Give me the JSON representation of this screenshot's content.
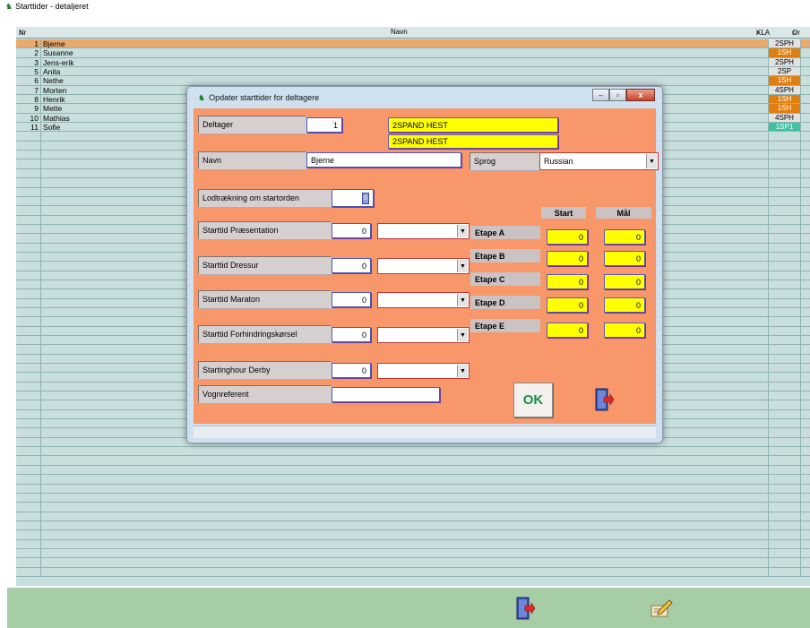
{
  "main": {
    "title": "Starttider - detaljeret",
    "columns": {
      "nr": "Nr",
      "navn": "Navn",
      "kla": "KLA",
      "or": "Or"
    },
    "rows": [
      {
        "nr": "1",
        "name": "Bjerne",
        "kla": "2SPH",
        "selected": true
      },
      {
        "nr": "2",
        "name": "Susanne",
        "kla": "1SH"
      },
      {
        "nr": "3",
        "name": "Jens-erik",
        "kla": "2SPH"
      },
      {
        "nr": "5",
        "name": "Anita",
        "kla": "2SP"
      },
      {
        "nr": "6",
        "name": "Nethe",
        "kla": "1SH"
      },
      {
        "nr": "7",
        "name": "Morten",
        "kla": "4SPH"
      },
      {
        "nr": "8",
        "name": "Henrik",
        "kla": "1SH"
      },
      {
        "nr": "9",
        "name": "Mette",
        "kla": "1SH"
      },
      {
        "nr": "10",
        "name": "Mathias",
        "kla": "4SPH"
      },
      {
        "nr": "11",
        "name": "Sofie",
        "kla": "1SP1"
      }
    ],
    "empty_rows": 48
  },
  "dialog": {
    "title": "Opdater starttider for deltagere",
    "deltager_label": "Deltager",
    "deltager_value": "1",
    "class_line1": "2SPAND HEST",
    "class_line2": "2SPAND HEST",
    "navn_label": "Navn",
    "navn_value": "Bjerne",
    "sprog_label": "Sprog",
    "sprog_value": "Russian",
    "lodtraekning_label": "Lodtrækning om startorden",
    "lodtraekning_value": "0",
    "col_start": "Start",
    "col_maal": "Mål",
    "starttimes": [
      {
        "label": "Starttid Præsentation",
        "value": "0",
        "selected": ""
      },
      {
        "label": "Starttid Dressur",
        "value": "0",
        "selected": ""
      },
      {
        "label": "Starttid Maraton",
        "value": "0",
        "selected": ""
      },
      {
        "label": "Starttid Forhindringskørsel",
        "value": "0",
        "selected": ""
      },
      {
        "label": "Startinghour Derby",
        "value": "0",
        "selected": ""
      }
    ],
    "etaper": [
      {
        "label": "Etape A",
        "start": "0",
        "maal": "0"
      },
      {
        "label": "Etape B",
        "start": "0",
        "maal": "0"
      },
      {
        "label": "Etape C",
        "start": "0",
        "maal": "0"
      },
      {
        "label": "Etape D",
        "start": "0",
        "maal": "0"
      },
      {
        "label": "Etape E",
        "start": "0",
        "maal": "0"
      }
    ],
    "vognreferent_label": "Vognreferent",
    "vognreferent_value": "",
    "ok_label": "OK"
  },
  "icons": {
    "exit": "exit-door-icon",
    "edit": "edit-pencil-icon",
    "search": "search-icon",
    "horse": "horse-icon"
  },
  "colors": {
    "dialog_body": "#f7976a",
    "grid": "#c9dfde",
    "selected_row": "#e9a86c",
    "kla_1SH": "#e07f10",
    "kla_1SP1": "#3cc3a4",
    "highlight_field": "#ffff00",
    "footer": "#a7cda6"
  }
}
